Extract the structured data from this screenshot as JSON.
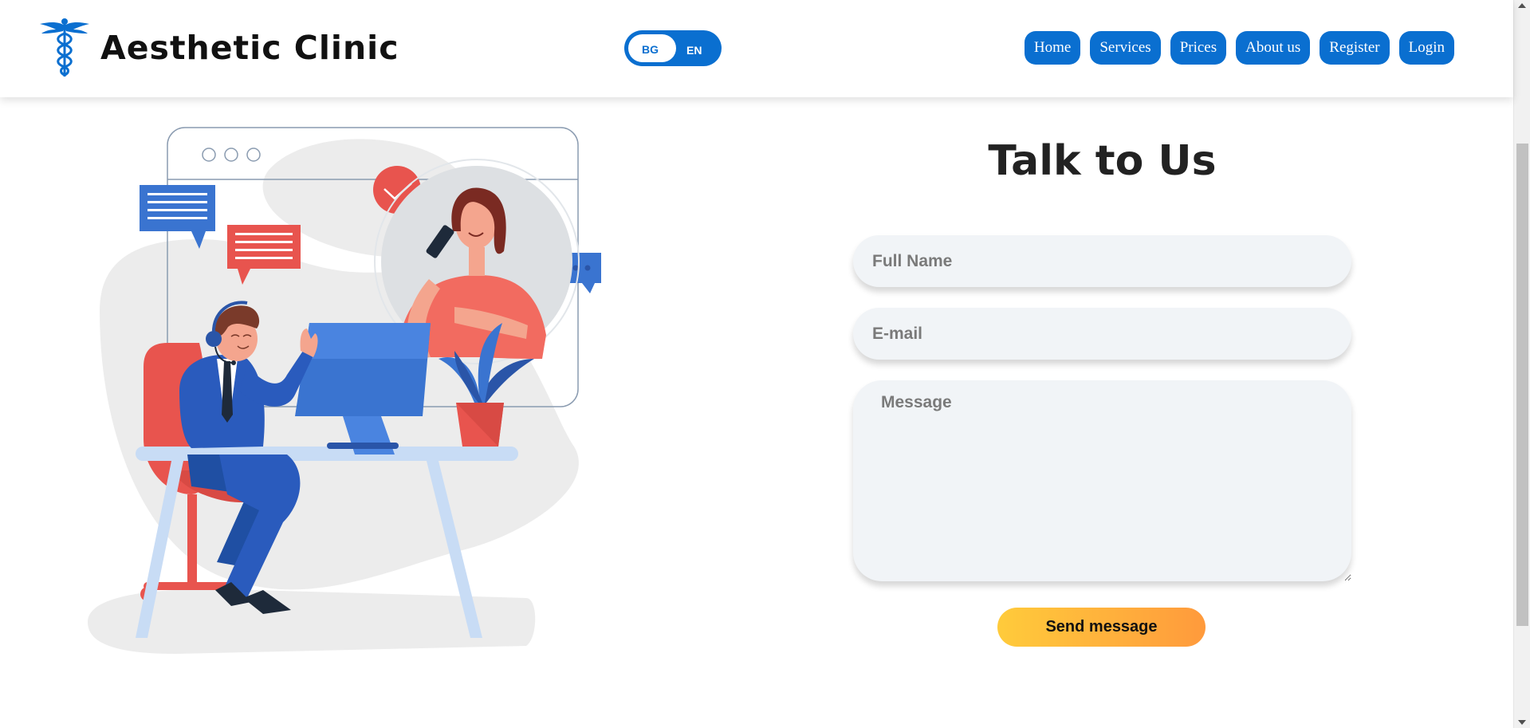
{
  "header": {
    "brand": "Aesthetic Clinic",
    "logo_icon": "caduceus-icon",
    "language": {
      "options": [
        "BG",
        "EN"
      ],
      "selected": "BG"
    },
    "nav": [
      "Home",
      "Services",
      "Prices",
      "About us",
      "Register",
      "Login"
    ]
  },
  "contact_form": {
    "title": "Talk to Us",
    "full_name_placeholder": "Full Name",
    "email_placeholder": "E-mail",
    "message_placeholder": "Message",
    "submit_label": "Send message"
  },
  "colors": {
    "primary_blue": "#0a6fd0",
    "accent_red": "#e8544e",
    "button_gradient_start": "#ffcb3b",
    "button_gradient_end": "#ff9a3c",
    "field_bg": "#f1f4f7"
  }
}
